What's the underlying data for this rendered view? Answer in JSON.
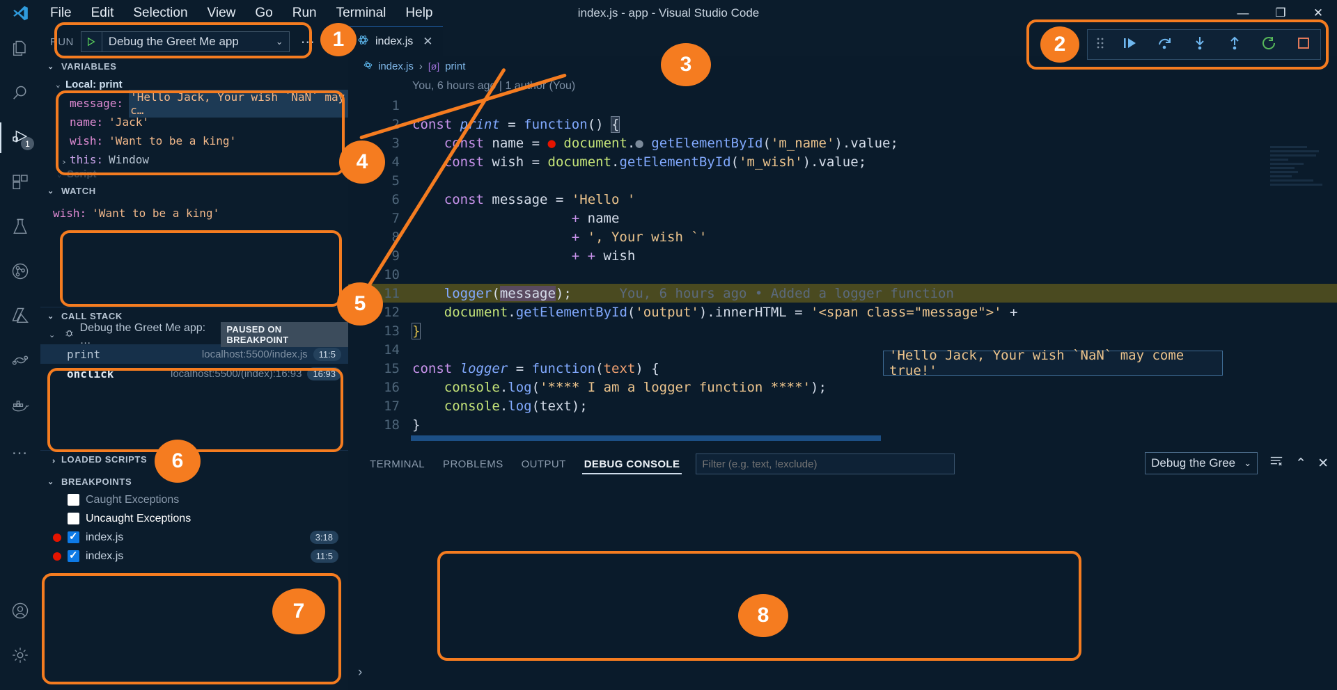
{
  "window": {
    "title": "index.js - app - Visual Studio Code",
    "menus": [
      "File",
      "Edit",
      "Selection",
      "View",
      "Go",
      "Run",
      "Terminal",
      "Help"
    ],
    "controls": [
      "minimize-icon",
      "maximize-icon",
      "close-icon"
    ]
  },
  "activity_bar": {
    "items": [
      {
        "name": "explorer-icon",
        "label": "Explorer",
        "badge": ""
      },
      {
        "name": "search-icon",
        "label": "Search",
        "badge": ""
      },
      {
        "name": "run-and-debug-icon",
        "label": "Run and Debug",
        "badge": "1",
        "active": true
      },
      {
        "name": "extensions-icon",
        "label": "Extensions",
        "badge": ""
      },
      {
        "name": "testing-icon",
        "label": "Testing",
        "badge": ""
      },
      {
        "name": "source-control-icon",
        "label": "Source Control",
        "badge": ""
      },
      {
        "name": "azure-icon",
        "label": "Azure",
        "badge": ""
      },
      {
        "name": "remote-explorer-icon",
        "label": "Remote Explorer",
        "badge": ""
      },
      {
        "name": "docker-icon",
        "label": "Docker",
        "badge": ""
      },
      {
        "name": "more-icon",
        "label": "More",
        "badge": ""
      }
    ],
    "bottom": [
      {
        "name": "accounts-icon",
        "label": "Accounts"
      },
      {
        "name": "settings-gear-icon",
        "label": "Manage"
      }
    ]
  },
  "run_panel": {
    "run_label": "RUN",
    "play_icon": "play-icon",
    "configuration": "Debug the Greet Me app",
    "chevron": "chevron-down-icon",
    "more_icon": "ellipsis-icon"
  },
  "variables": {
    "title": "VARIABLES",
    "scope": "Local: print",
    "rows": [
      {
        "key": "message:",
        "value": "'Hello Jack, Your wish `NaN` may c…",
        "selected": true,
        "expandable": false
      },
      {
        "key": "name:",
        "value": "'Jack'",
        "selected": false,
        "expandable": false
      },
      {
        "key": "wish:",
        "value": "'Want to be a king'",
        "selected": false,
        "expandable": false
      },
      {
        "key": "this:",
        "value": "Window",
        "selected": false,
        "expandable": true
      }
    ],
    "hidden_scope": "Script"
  },
  "watch": {
    "title": "WATCH",
    "rows": [
      {
        "key": "wish:",
        "value": "'Want to be a king'"
      }
    ]
  },
  "call_stack": {
    "title": "CALL STACK",
    "session": "Debug the Greet Me app: …",
    "session_icon": "bug-icon",
    "status_badge": "PAUSED ON BREAKPOINT",
    "frames": [
      {
        "name": "print",
        "source": "localhost:5500/index.js",
        "position": "11:5",
        "selected": true
      },
      {
        "name": "onclick",
        "source": "localhost:5500/(index):16:93",
        "position": "16:93",
        "selected": false
      }
    ]
  },
  "loaded_scripts": {
    "title": "LOADED SCRIPTS"
  },
  "breakpoints": {
    "title": "BREAKPOINTS",
    "rows": [
      {
        "label": "Caught Exceptions",
        "checked": false,
        "dot": false,
        "line": "",
        "dim": true
      },
      {
        "label": "Uncaught Exceptions",
        "checked": false,
        "dot": false,
        "line": "",
        "dim": false
      },
      {
        "label": "index.js",
        "checked": true,
        "dot": true,
        "line": "3:18",
        "dim": false
      },
      {
        "label": "index.js",
        "checked": true,
        "dot": true,
        "line": "11:5",
        "dim": false
      }
    ]
  },
  "editor": {
    "tab": {
      "label": "index.js",
      "icon": "js-file-icon",
      "close": "close-icon"
    },
    "breadcrumb": {
      "file": "index.js",
      "separator": "›",
      "symbol": "print",
      "symbol_icon": "method-icon"
    },
    "codelens_top": "You, 6 hours ago | 1 author (You)",
    "hover_tooltip": "'Hello Jack, Your wish `NaN` may come true!'",
    "lines": [
      {
        "n": "1",
        "text": "",
        "highlight": false,
        "breakpoint": false,
        "arrow": false
      },
      {
        "n": "2",
        "text": "const print = function() {",
        "highlight": false,
        "breakpoint": false,
        "arrow": false
      },
      {
        "n": "3",
        "text": "    const name = document.getElementById('m_name').value;",
        "highlight": false,
        "breakpoint": true,
        "arrow": false
      },
      {
        "n": "4",
        "text": "    const wish = document.getElementById('m_wish').value;",
        "highlight": false,
        "breakpoint": false,
        "arrow": false
      },
      {
        "n": "5",
        "text": "",
        "highlight": false,
        "breakpoint": false,
        "arrow": false
      },
      {
        "n": "6",
        "text": "    const message = 'Hello '",
        "highlight": false,
        "breakpoint": false,
        "arrow": false
      },
      {
        "n": "7",
        "text": "                    + name",
        "highlight": false,
        "breakpoint": false,
        "arrow": false
      },
      {
        "n": "8",
        "text": "                    + ', Your wish `'",
        "highlight": false,
        "breakpoint": false,
        "arrow": false
      },
      {
        "n": "9",
        "text": "                    + + wish",
        "highlight": false,
        "breakpoint": false,
        "arrow": false
      },
      {
        "n": "10",
        "text": "",
        "highlight": false,
        "breakpoint": false,
        "arrow": false
      },
      {
        "n": "11",
        "text": "    logger(message);",
        "codelens": "You, 6 hours ago • Added a logger function",
        "highlight": true,
        "breakpoint": false,
        "arrow": true
      },
      {
        "n": "12",
        "text": "    document.getElementById('output').innerHTML = '<span class=\"message\">' +",
        "highlight": false,
        "breakpoint": false,
        "arrow": false
      },
      {
        "n": "13",
        "text": "}",
        "highlight": false,
        "breakpoint": false,
        "arrow": false
      },
      {
        "n": "14",
        "text": "",
        "highlight": false,
        "breakpoint": false,
        "arrow": false
      },
      {
        "n": "15",
        "text": "const logger = function(text) {",
        "highlight": false,
        "breakpoint": false,
        "arrow": false
      },
      {
        "n": "16",
        "text": "    console.log('**** I am a logger function ****');",
        "highlight": false,
        "breakpoint": false,
        "arrow": false
      },
      {
        "n": "17",
        "text": "    console.log(text);",
        "highlight": false,
        "breakpoint": false,
        "arrow": false
      },
      {
        "n": "18",
        "text": "}",
        "highlight": false,
        "breakpoint": false,
        "arrow": false
      }
    ]
  },
  "debug_toolbar": {
    "buttons": [
      {
        "name": "drag-handle-icon",
        "label": "Drag"
      },
      {
        "name": "continue-icon",
        "label": "Continue"
      },
      {
        "name": "step-over-icon",
        "label": "Step Over"
      },
      {
        "name": "step-into-icon",
        "label": "Step Into"
      },
      {
        "name": "step-out-icon",
        "label": "Step Out"
      },
      {
        "name": "restart-icon",
        "label": "Restart"
      },
      {
        "name": "stop-icon",
        "label": "Stop"
      }
    ]
  },
  "bottom_panel": {
    "tabs": [
      {
        "label": "TERMINAL",
        "active": false
      },
      {
        "label": "PROBLEMS",
        "active": false
      },
      {
        "label": "OUTPUT",
        "active": false
      },
      {
        "label": "DEBUG CONSOLE",
        "active": true
      }
    ],
    "filter_placeholder": "Filter (e.g. text, !exclude)",
    "session_select": "Debug the Gree",
    "session_chevron": "chevron-down-icon",
    "clear_icon": "clear-console-icon",
    "maximize_icon": "chevron-up-icon",
    "close_icon": "close-icon",
    "prompt": "›"
  },
  "annotations": {
    "accent": "#f57c20",
    "bubbles": [
      {
        "number": "1",
        "target": "run-configuration"
      },
      {
        "number": "2",
        "target": "debug-toolbar"
      },
      {
        "number": "3",
        "target": "breakpoint-markers"
      },
      {
        "number": "4",
        "target": "variables-pane"
      },
      {
        "number": "5",
        "target": "watch-pane"
      },
      {
        "number": "6",
        "target": "call-stack-pane"
      },
      {
        "number": "7",
        "target": "breakpoints-pane"
      },
      {
        "number": "8",
        "target": "debug-console-pane"
      }
    ]
  }
}
